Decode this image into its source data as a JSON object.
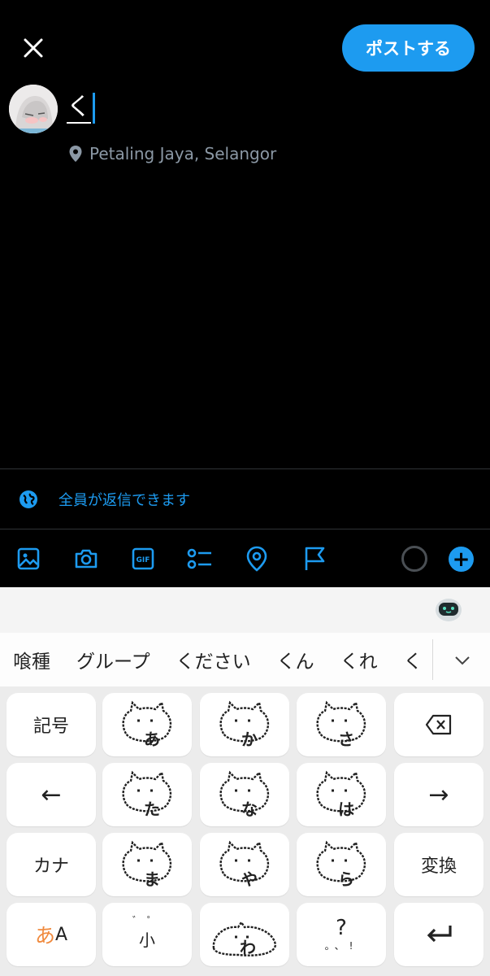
{
  "compose": {
    "post_button": "ポストする",
    "typed_text": "く",
    "location": "Petaling Jaya, Selangor",
    "reply_setting": "全員が返信できます"
  },
  "toolbar": {
    "icons": [
      "image-icon",
      "camera-icon",
      "gif-icon",
      "poll-icon",
      "location-icon",
      "flag-icon"
    ],
    "accent_color": "#1d9bf0"
  },
  "keyboard": {
    "candidates": [
      "喰種",
      "グループ",
      "ください",
      "くん",
      "くれ",
      "く"
    ],
    "keys": {
      "symbols": "記号",
      "left_arrow": "←",
      "right_arrow": "→",
      "katakana": "カナ",
      "convert": "変換",
      "kana_mode_a": "あ",
      "kana_mode_b": "A",
      "small": "小",
      "punct": "?"
    },
    "stickers": [
      "あ",
      "か",
      "さ",
      "た",
      "な",
      "は",
      "ま",
      "や",
      "ら",
      "わ"
    ]
  }
}
